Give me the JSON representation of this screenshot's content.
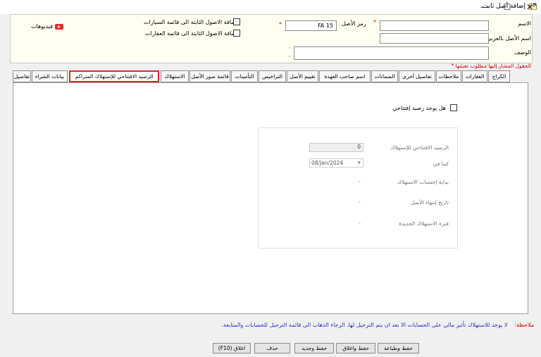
{
  "window": {
    "title": "إضافة أصل ثابت",
    "minimize": "—",
    "maximize": "☐",
    "close": "✕"
  },
  "header": {
    "name_label": "الاسم",
    "arabic_name_label": "اسم الأصل بالعربي",
    "description_label": "الوصف",
    "asset_code_label": "رمز الأصل",
    "asset_code_value": "FA 15",
    "required_mark": "*",
    "add_to_vehicles_label": "إضافة الاصول الثابتة الى قائمة السيارات",
    "add_to_realestate_label": "إضافة الاصول الثابتة الى قائمة العقارات",
    "videos_label": "فيديوهات",
    "required_note": "الحقول المشار إليها مطلوب تعبئتها *"
  },
  "tabs": [
    {
      "label": "تفاصيل"
    },
    {
      "label": "بيانات الشراء"
    },
    {
      "label": "الرصيد الافتتاحي للإستهلاك المتراكم",
      "active": true
    },
    {
      "label": "الاستهلاك"
    },
    {
      "label": "قائمة صور الأصل"
    },
    {
      "label": "التأمينات"
    },
    {
      "label": "التراخيص"
    },
    {
      "label": "تقييم الأصل"
    },
    {
      "label": "اسم صاحب العهدة"
    },
    {
      "label": "الضمانات"
    },
    {
      "label": "تفاصيل أخرى"
    },
    {
      "label": "ملاحظات"
    },
    {
      "label": "العقارات"
    },
    {
      "label": "الكراج"
    }
  ],
  "opening": {
    "has_opening_label": "هل يوجد رصيد إفتتاحي",
    "fields": {
      "opening_balance_label": "الرصيد الافتتاحي للإستهلاك",
      "opening_balance_value": "0",
      "as_of_label": "كما في",
      "as_of_value": "08/Jan/2024",
      "depr_start_label": "بداية إحتساب الاستهلاك",
      "depr_start_value": "-",
      "asset_end_label": "تاريخ إنتهاء الأصل",
      "asset_end_value": "-",
      "new_period_label": "فترة الاستهلاك الجديدة",
      "new_period_value": "-"
    }
  },
  "footer": {
    "note_label": "ملاحظة:",
    "note_text": "لا يوجد للاستهلاك تأثير مالي على الحسابات الا بعد ان يتم الترحيل لها. الرجاء الذهاب الى قائمة الترحيل للحسابات والمتابعة.",
    "buttons": {
      "save_print": "حفظ وطباعة",
      "save_close": "حفظ واغلاق",
      "save_new": "حفظ وجديد",
      "delete": "حذف",
      "close": "اغلاق (F10)"
    }
  },
  "colors": {
    "active_tab_border": "#e0252b",
    "required": "#d00000",
    "note_text": "#2d2dc8",
    "header_bg": "#fffef2"
  }
}
